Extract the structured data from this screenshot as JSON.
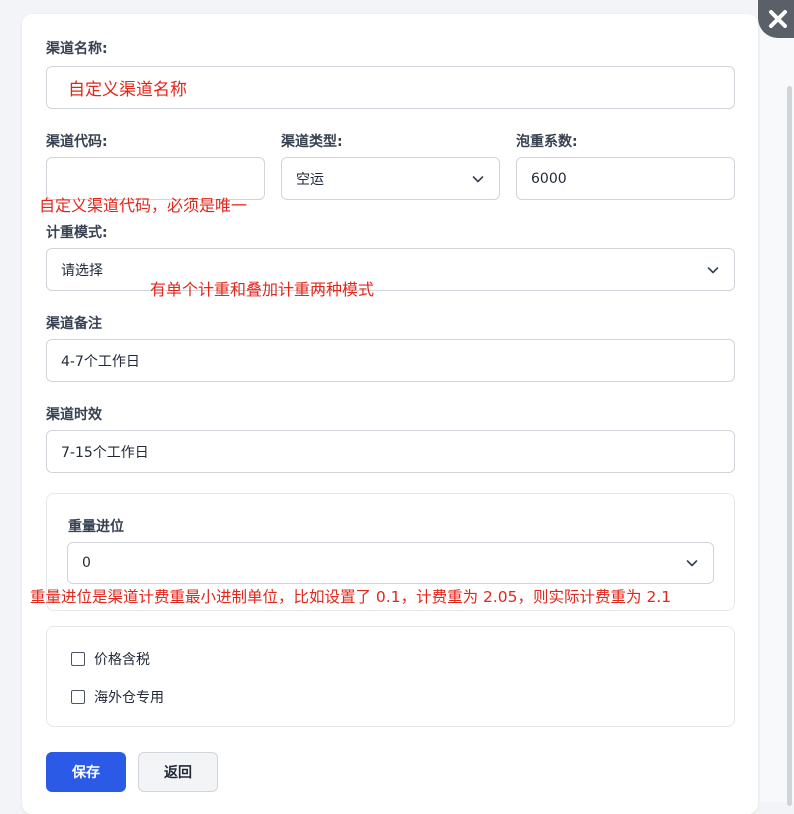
{
  "form": {
    "channel_name": {
      "label": "渠道名称:",
      "value": "",
      "annotation": "自定义渠道名称"
    },
    "channel_code": {
      "label": "渠道代码:",
      "value": "",
      "annotation": "自定义渠道代码，必须是唯一"
    },
    "channel_type": {
      "label": "渠道类型:",
      "value": "空运"
    },
    "volume_factor": {
      "label": "泡重系数:",
      "value": "6000"
    },
    "weight_mode": {
      "label": "计重模式:",
      "value": "请选择",
      "annotation": "有单个计重和叠加计重两种模式"
    },
    "channel_remark": {
      "label": "渠道备注",
      "value": "4-7个工作日"
    },
    "channel_timeliness": {
      "label": "渠道时效",
      "value": "7-15个工作日"
    },
    "weight_rounding": {
      "label": "重量进位",
      "value": "0",
      "annotation": "重量进位是渠道计费重最小进制单位，比如设置了 0.1，计费重为 2.05，则实际计费重为 2.1"
    },
    "options": [
      {
        "label": "价格含税",
        "checked": false
      },
      {
        "label": "海外仓专用",
        "checked": false
      }
    ]
  },
  "actions": {
    "save_label": "保存",
    "back_label": "返回"
  },
  "colors": {
    "primary": "#2b5be6",
    "annotation": "#e3261b"
  },
  "icons": {
    "close": "close-icon",
    "select": "chevron-down-icon"
  }
}
